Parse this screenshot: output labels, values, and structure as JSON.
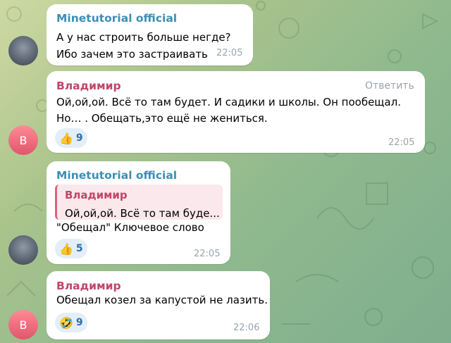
{
  "messages": [
    {
      "sender": "Minetutorial official",
      "lines": [
        "А у нас строить больше негде?",
        "Ибо зачем это застраивать"
      ],
      "time": "22:05"
    },
    {
      "sender": "Владимир",
      "avatar_letter": "В",
      "reply_label": "Ответить",
      "lines": [
        "Ой,ой,ой. Всё то там будет. И садики и школы. Он пообещал.",
        "Но… . Обещать,это ещё не жениться."
      ],
      "reaction": {
        "emoji": "👍",
        "count": "9"
      },
      "time": "22:05"
    },
    {
      "sender": "Minetutorial official",
      "quote": {
        "name": "Владимир",
        "text": "Ой,ой,ой. Всё то там буде..."
      },
      "lines": [
        "\"Обещал\" Ключевое слово"
      ],
      "reaction": {
        "emoji": "👍",
        "count": "5"
      },
      "time": "22:05"
    },
    {
      "sender": "Владимир",
      "avatar_letter": "В",
      "lines": [
        "Обещал козел за капустой не лазить."
      ],
      "reaction": {
        "emoji": "🤣",
        "count": "9"
      },
      "time": "22:06"
    }
  ]
}
